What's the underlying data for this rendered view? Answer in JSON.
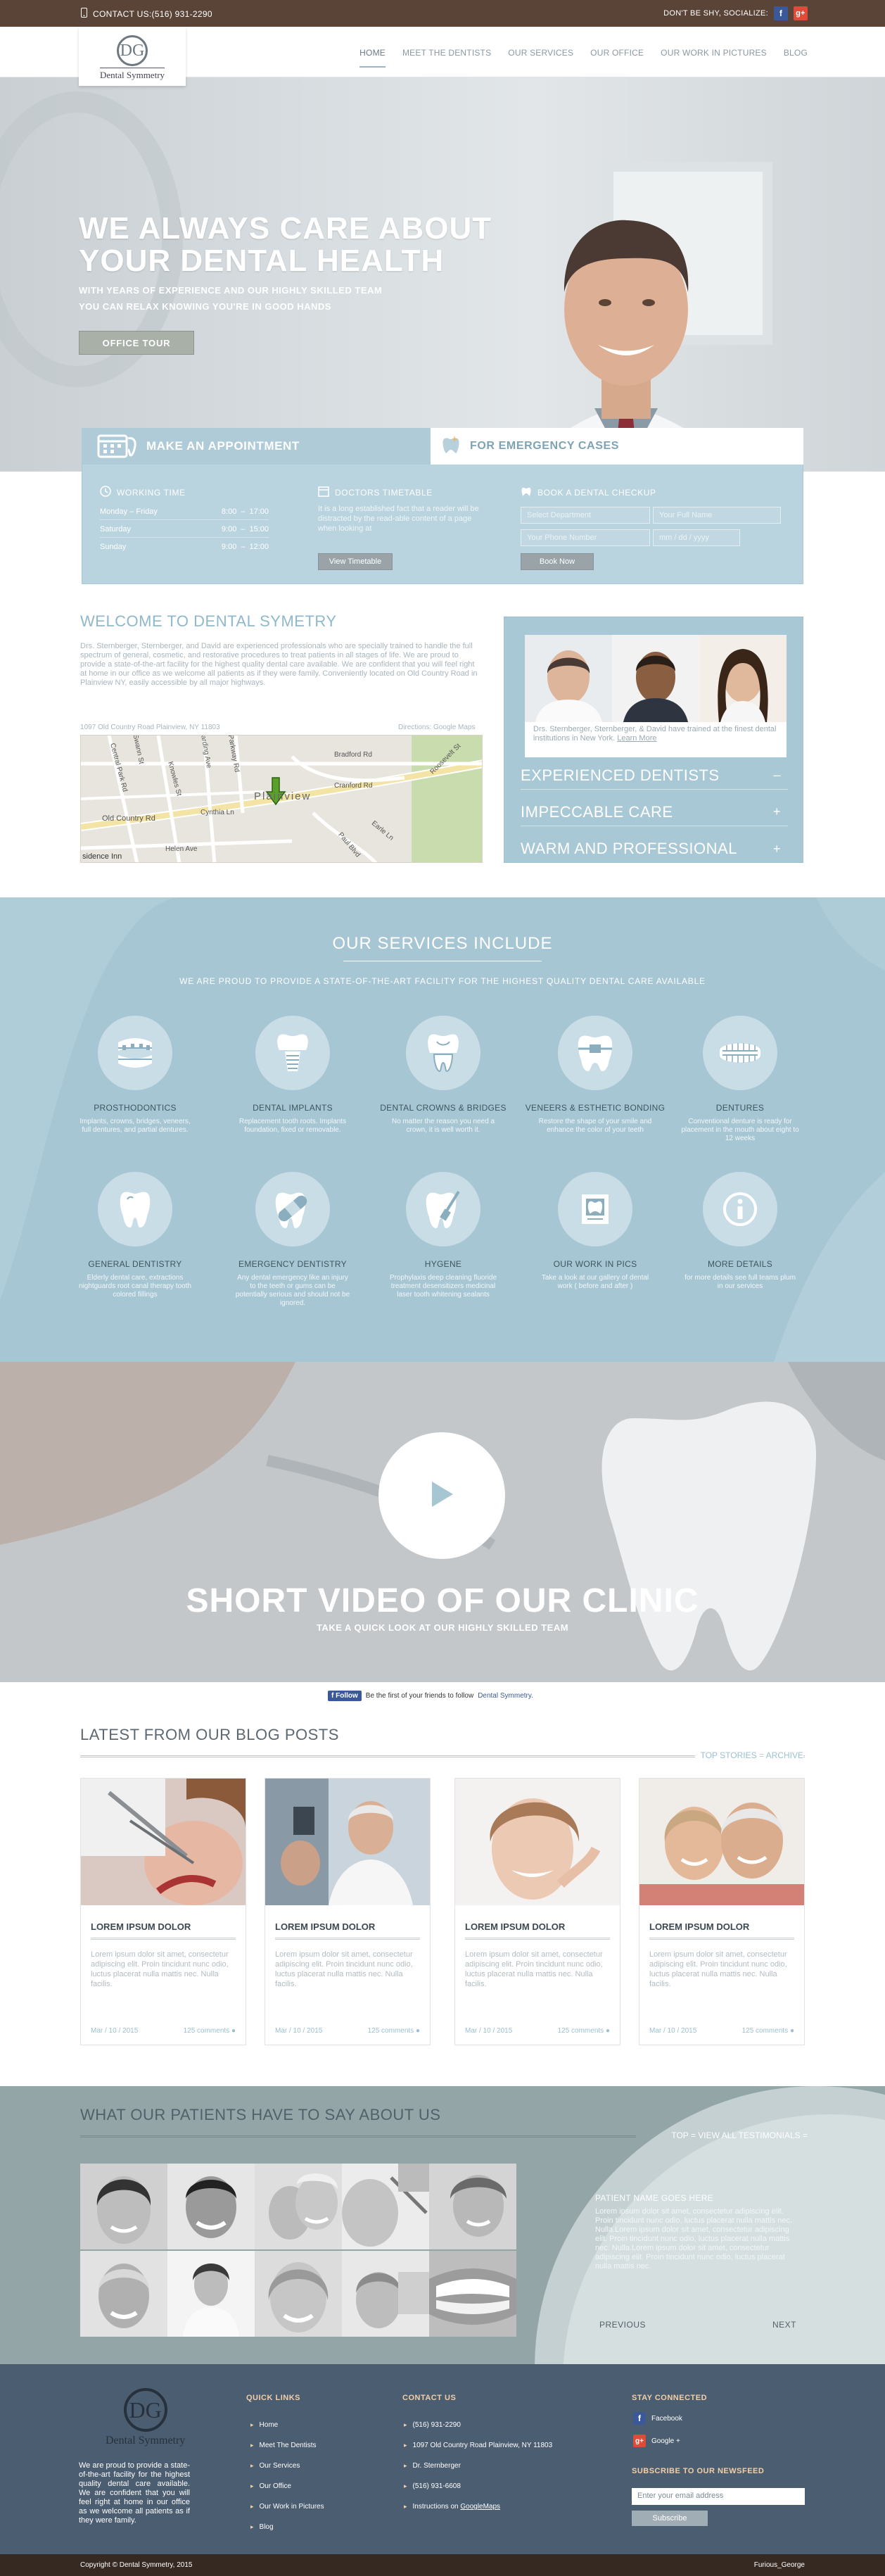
{
  "topbar": {
    "contact": "CONTACT US:(516) 931-2290",
    "social_label": "DON'T BE SHY, SOCIALIZE:",
    "facebook_glyph": "f",
    "google_glyph": "g+"
  },
  "logo": {
    "mark": "DG",
    "name": "Dental Symmetry"
  },
  "nav": {
    "items": [
      "HOME",
      "MEET THE DENTISTS",
      "OUR SERVICES",
      "OUR OFFICE",
      "OUR WORK IN PICTURES",
      "BLOG"
    ],
    "active": "HOME"
  },
  "hero": {
    "title_line1": "WE ALWAYS CARE ABOUT",
    "title_line2": "YOUR DENTAL HEALTH",
    "sub1": "WITH YEARS OF EXPERIENCE AND OUR HIGHLY SKILLED TEAM",
    "sub2": "YOU CAN RELAX KNOWING YOU'RE IN GOOD HANDS",
    "button": "OFFICE TOUR"
  },
  "appointment": {
    "tab1": "MAKE AN APPOINTMENT",
    "tab2": "FOR EMERGENCY CASES",
    "working_time": {
      "heading": "WORKING TIME",
      "rows": [
        {
          "day": "Monday – Friday",
          "open": "8:00",
          "close": "17:00"
        },
        {
          "day": "Saturday",
          "open": "9:00",
          "close": "15:00"
        },
        {
          "day": "Sunday",
          "open": "9:00",
          "close": "12:00"
        }
      ]
    },
    "timetable": {
      "heading": "DOCTORS TIMETABLE",
      "text": "It is a long established fact that a reader will be distracted by the read-able content of a page when looking at",
      "button": "View Timetable"
    },
    "checkup": {
      "heading": "BOOK A DENTAL CHECKUP",
      "department": "Select Department",
      "full_name": "Your Full Name",
      "phone": "Your Phone Number",
      "date": "mm / dd / yyyy",
      "button": "Book Now"
    }
  },
  "welcome": {
    "title": "WELCOME TO DENTAL SYMETRY",
    "text": "Drs. Sternberger, Sternberger, and David are experienced professionals who are specially trained to handle the full spectrum of general, cosmetic, and restorative procedures to treat patients in all stages of life. We are proud to provide a state-of-the-art facility for the highest quality dental care available. We are confident that you will feel right at home in our office as we welcome all patients as if they were family. Conveniently located on Old Country Road in Plainview NY, easily accessible by all major highways.",
    "address": "1097 Old Country Road Plainview, NY 11803",
    "directions": "Directions: Google Maps"
  },
  "map": {
    "labels": [
      "Bradford Rd",
      "Cranford Rd",
      "Plainview",
      "Old Country Rd",
      "Cynthia Ln",
      "Helen Ave",
      "Knowles St",
      "Central Park Rd",
      "Roosevelt St",
      "Earle Ln",
      "Paul Blvd",
      "Harding Ave",
      "sidence Inn",
      "Swann St",
      "Parkway Rd"
    ]
  },
  "team": {
    "caption": "Drs. Sternberger, Sternberger, & David have trained at the finest dental institutions in New York.",
    "learn_more": "Learn More",
    "accordion": [
      {
        "label": "EXPERIENCED DENTISTS",
        "sign": "–"
      },
      {
        "label": "IMPECCABLE CARE",
        "sign": "+"
      },
      {
        "label": "WARM AND PROFESSIONAL",
        "sign": "+"
      }
    ]
  },
  "services": {
    "title": "OUR SERVICES INCLUDE",
    "tagline": "WE ARE PROUD TO PROVIDE A STATE-OF-THE-ART FACILITY FOR THE HIGHEST QUALITY DENTAL CARE AVAILABLE",
    "items": [
      {
        "title": "PROSTHODONTICS",
        "desc": "Implants, crowns, bridges, veneers, full dentures, and partial dentures.",
        "icon": "braces-icon"
      },
      {
        "title": "DENTAL IMPLANTS",
        "desc": "Replacement tooth roots. Implants foundation, fixed or removable.",
        "icon": "implant-icon"
      },
      {
        "title": "DENTAL CROWNS & BRIDGES",
        "desc": "No matter the reason you need a crown, it is well worth it.",
        "icon": "crown-icon"
      },
      {
        "title": "VENEERS & ESTHETIC BONDING",
        "desc": "Restore the shape of your smile and enhance the color of your teeth",
        "icon": "veneer-icon"
      },
      {
        "title": "DENTURES",
        "desc": "Conventional denture is ready for placement in the mouth about eight to 12 weeks",
        "icon": "dentures-icon"
      },
      {
        "title": "GENERAL DENTISTRY",
        "desc": "Elderly dental care, extractions nightguards root canal therapy tooth colored fillings",
        "icon": "tooth-icon"
      },
      {
        "title": "EMERGENCY DENTISTRY",
        "desc": "Any dental emergency like an injury to the teeth or gums can be potentially serious and should not be ignored.",
        "icon": "bandaid-tooth-icon"
      },
      {
        "title": "HYGENE",
        "desc": "Prophylaxis deep cleaning fluoride treatment desensitizers medicinal laser tooth whitening sealants",
        "icon": "toothbrush-icon"
      },
      {
        "title": "OUR WORK IN PICS",
        "desc": "Take a look at our gallery of dental work ( before and after )",
        "icon": "photo-icon"
      },
      {
        "title": "MORE DETAILS",
        "desc": "for more details see full teams plum in our services",
        "icon": "info-icon"
      }
    ]
  },
  "video": {
    "title": "SHORT VIDEO OF OUR CLINIC",
    "tagline": "TAKE A QUICK LOOK AT OUR HIGHLY SKILLED TEAM"
  },
  "follow": {
    "button": "f Follow",
    "text": "Be the first of your friends to follow",
    "link": "Dental Symmetry."
  },
  "blog": {
    "title": "LATEST FROM OUR BLOG POSTS",
    "top_stories": "TOP STORIES",
    "archive": "ARCHIVE",
    "posts": [
      {
        "title": "LOREM IPSUM DOLOR",
        "text": "Lorem ipsum dolor sit amet, consectetur adipiscing elit. Proin tincidunt nunc odio, luctus placerat nulla mattis nec. Nulla facilis.",
        "date": "Mar / 10 / 2015",
        "comments": "125 comments"
      },
      {
        "title": "LOREM IPSUM DOLOR",
        "text": "Lorem ipsum dolor sit amet, consectetur adipiscing elit. Proin tincidunt nunc odio, luctus placerat nulla mattis nec. Nulla facilis.",
        "date": "Mar / 10 / 2015",
        "comments": "125 comments"
      },
      {
        "title": "LOREM IPSUM DOLOR",
        "text": "Lorem ipsum dolor sit amet, consectetur adipiscing elit. Proin tincidunt nunc odio, luctus placerat nulla mattis nec. Nulla facilis.",
        "date": "Mar / 10 / 2015",
        "comments": "125 comments"
      },
      {
        "title": "LOREM IPSUM DOLOR",
        "text": "Lorem ipsum dolor sit amet, consectetur adipiscing elit. Proin tincidunt nunc odio, luctus placerat nulla mattis nec. Nulla facilis.",
        "date": "Mar / 10 / 2015",
        "comments": "125 comments"
      }
    ]
  },
  "testimonials": {
    "title": "WHAT OUR PATIENTS HAVE TO SAY ABOUT US",
    "top": "TOP",
    "view_all": "VIEW ALL TESTIMONIALS",
    "name": "PATIENT NAME GOES HERE",
    "quote": "Lorem ipsum dolor sit amet, consectetur adipiscing elit. Proin tincidunt nunc odio, luctus placerat nulla mattis nec. Nulla.Lorem ipsum dolor sit amet, consectetur adipiscing elit. Proin tincidunt nunc odio, luctus placerat nulla mattis nec. Nulla.Lorem ipsum dolor sit amet, consectetur adipiscing elit. Proin tincidunt nunc odio, luctus placerat nulla mattis nec.",
    "prev": "PREVIOUS",
    "next": "NEXT"
  },
  "footer": {
    "logo_mark": "DG",
    "logo_name": "Dental Symmetry",
    "about": "We are proud to provide a state-of-the-art facility for the highest quality dental care available. We are confident that you will feel right at home in our office as we welcome all patients as if they were family.",
    "quick_links_title": "QUICK LINKS",
    "quick_links": [
      "Home",
      "Meet The Dentists",
      "Our Services",
      "Our Office",
      "Our Work in Pictures",
      "Blog"
    ],
    "contact_title": "CONTACT US",
    "contact": [
      "(516) 931-2290",
      "1097 Old Country Road Plainview, NY 11803",
      "Dr. Sternberger",
      "(516) 931-6608"
    ],
    "instructions": "Instructions on",
    "googlemaps": "GoogleMaps",
    "stay_title": "STAY CONNECTED",
    "facebook": "Facebook",
    "google": "Google +",
    "newsletter_title": "SUBSCRIBE TO OUR NEWSFEED",
    "email_placeholder": "Enter your email address",
    "subscribe": "Subscribe"
  },
  "bottom": {
    "copyright": "Copyright © Dental Symmetry, 2015",
    "credit": "Furious_George"
  },
  "colors": {
    "topbar": "#5a4438",
    "accent_blue": "#a7c6d4",
    "footer": "#4b5d70",
    "bottombar": "#362922"
  }
}
